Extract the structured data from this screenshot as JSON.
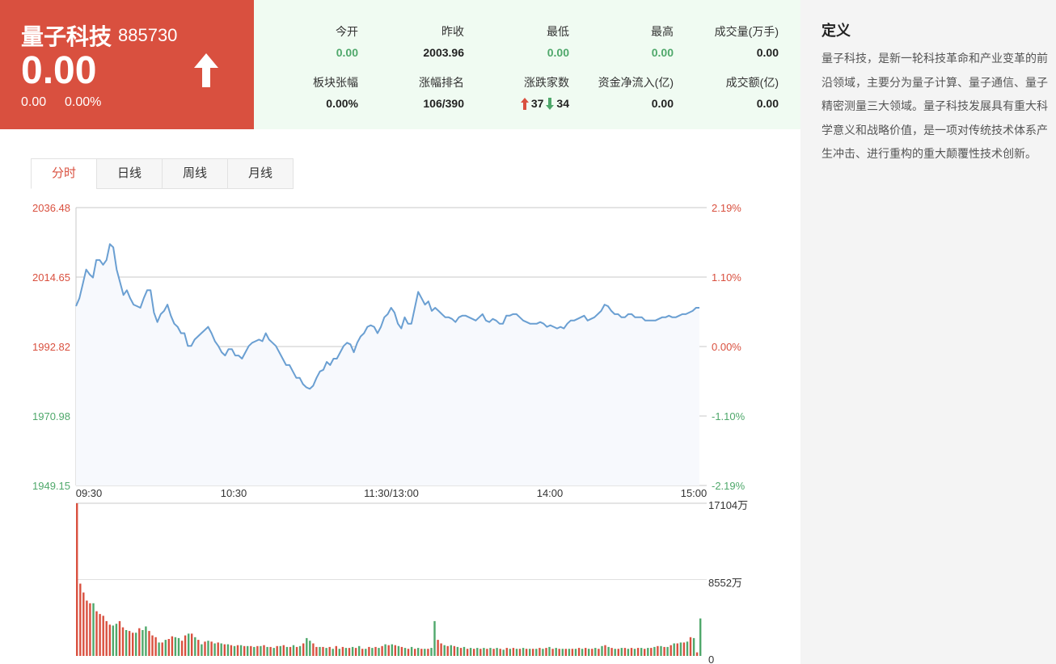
{
  "header": {
    "name": "量子科技",
    "code": "885730",
    "price": "0.00",
    "change": "0.00",
    "change_pct": "0.00%",
    "direction_icon": "arrow-up-icon"
  },
  "stats": {
    "open_label": "今开",
    "open": "0.00",
    "prev_close_label": "昨收",
    "prev_close": "2003.96",
    "low_label": "最低",
    "low": "0.00",
    "high_label": "最高",
    "high": "0.00",
    "volume_label": "成交量(万手)",
    "volume": "0.00",
    "sector_change_label": "板块张幅",
    "sector_change": "0.00%",
    "rank_label": "涨幅排名",
    "rank": "106/390",
    "updown_label": "涨跌家数",
    "up_count": "37",
    "down_count": "34",
    "net_flow_label": "资金净流入(亿)",
    "net_flow": "0.00",
    "turnover_label": "成交额(亿)",
    "turnover": "0.00"
  },
  "definition": {
    "title": "定义",
    "text": "量子科技，是新一轮科技革命和产业变革的前沿领域，主要分为量子计算、量子通信、量子精密测量三大领域。量子科技发展具有重大科学意义和战略价值，是一项对传统技术体系产生冲击、进行重构的重大颠覆性技术创新。"
  },
  "tabs": [
    {
      "label": "分时",
      "active": true
    },
    {
      "label": "日线",
      "active": false
    },
    {
      "label": "周线",
      "active": false
    },
    {
      "label": "月线",
      "active": false
    }
  ],
  "colors": {
    "up": "#d9503f",
    "down": "#4fa86b",
    "line": "#6a9fd2",
    "area": "#f7f9fd",
    "grid": "#c8c8c8"
  },
  "chart_data": [
    {
      "type": "line",
      "title": "",
      "y_tick_labels": [
        "2036.48",
        "2014.65",
        "1992.82",
        "1970.98",
        "1949.15"
      ],
      "pct_tick_labels": [
        "2.19%",
        "1.10%",
        "0.00%",
        "-1.10%",
        "-2.19%"
      ],
      "x_tick_labels": [
        "09:30",
        "10:30",
        "11:30/13:00",
        "14:00",
        "15:00"
      ],
      "ylim": [
        1949.15,
        2036.48
      ],
      "baseline": 1992.82,
      "series": [
        {
          "values": [
            2005.5,
            2008,
            2012.5,
            2017,
            2015.5,
            2014.5,
            2020,
            2020,
            2018.5,
            2020,
            2025,
            2024,
            2017,
            2013,
            2009,
            2010.5,
            2008,
            2006,
            2005.5,
            2005,
            2008,
            2010.5,
            2010.5,
            2003.5,
            2000.5,
            2003,
            2004,
            2006,
            2002.5,
            2000,
            1999,
            1997,
            1997,
            1993,
            1993,
            1995,
            1996,
            1997,
            1998,
            1999,
            1997,
            1994.5,
            1993,
            1991,
            1990,
            1992,
            1992,
            1990,
            1990,
            1989,
            1991,
            1993,
            1994,
            1994.5,
            1995,
            1994.5,
            1997,
            1995,
            1994,
            1993,
            1991,
            1989,
            1987,
            1987,
            1985,
            1983,
            1983,
            1981,
            1980,
            1979.5,
            1980.5,
            1983,
            1985,
            1985.5,
            1988,
            1987,
            1989,
            1989,
            1991,
            1993,
            1994,
            1993.5,
            1991,
            1994,
            1996,
            1997,
            1999,
            1999.5,
            1999,
            1997,
            1999,
            2002,
            2003,
            2005,
            2003.5,
            2000,
            1998.5,
            2002,
            2000,
            2000,
            2005,
            2010,
            2008,
            2006,
            2007,
            2004,
            2005,
            2004,
            2003,
            2002,
            2002,
            2001.5,
            2000.5,
            2002,
            2002.5,
            2002.5,
            2002,
            2001.5,
            2001,
            2002,
            2003,
            2001,
            2000.5,
            2001.5,
            2001,
            2000,
            2000,
            2002.5,
            2002.5,
            2003,
            2003,
            2002,
            2001,
            2000.5,
            2000,
            2000,
            2000,
            2000.5,
            2000,
            1999,
            1999.5,
            1999,
            1998.5,
            1999,
            1998.5,
            2000,
            2001,
            2001,
            2001.5,
            2002,
            2002.5,
            2001,
            2001.5,
            2002,
            2003,
            2004,
            2006,
            2005.5,
            2004,
            2003,
            2003,
            2002,
            2002,
            2003,
            2003,
            2002,
            2002,
            2002,
            2001,
            2001,
            2001,
            2001,
            2001.5,
            2002,
            2002,
            2002.5,
            2002,
            2002,
            2002.5,
            2003,
            2003,
            2003.5,
            2004,
            2005,
            2005
          ]
        }
      ]
    },
    {
      "type": "bar",
      "title": "",
      "y_tick_labels": [
        "17104万",
        "8552万",
        "0"
      ],
      "ylim": [
        0,
        17104
      ],
      "values": [
        17104,
        8100,
        7100,
        6200,
        5900,
        5900,
        5000,
        4700,
        4500,
        3900,
        3500,
        3400,
        3600,
        3900,
        3200,
        2900,
        2800,
        2600,
        2600,
        3100,
        2900,
        3300,
        2800,
        2300,
        2100,
        1500,
        1500,
        1800,
        1900,
        2200,
        2100,
        2000,
        1700,
        2300,
        2500,
        2500,
        2100,
        1800,
        1300,
        1600,
        1700,
        1600,
        1400,
        1500,
        1400,
        1300,
        1300,
        1200,
        1100,
        1200,
        1200,
        1100,
        1100,
        1100,
        1000,
        1100,
        1100,
        1200,
        1000,
        1000,
        900,
        1100,
        1100,
        1200,
        1000,
        1000,
        1200,
        1000,
        1100,
        1400,
        2000,
        1700,
        1400,
        1000,
        1000,
        1000,
        900,
        1000,
        800,
        1100,
        800,
        1000,
        900,
        900,
        1000,
        900,
        1100,
        800,
        800,
        1000,
        900,
        1000,
        900,
        1100,
        1300,
        1200,
        1300,
        1200,
        1100,
        1000,
        900,
        800,
        1000,
        800,
        900,
        800,
        800,
        800,
        900,
        3900,
        1800,
        1400,
        1200,
        1100,
        1200,
        1100,
        1000,
        900,
        1000,
        800,
        900,
        800,
        900,
        800,
        900,
        800,
        900,
        800,
        900,
        800,
        700,
        900,
        800,
        900,
        800,
        800,
        900,
        800,
        800,
        800,
        800,
        900,
        800,
        900,
        1000,
        800,
        900,
        800,
        800,
        800,
        800,
        800,
        800,
        900,
        800,
        900,
        800,
        800,
        900,
        800,
        1100,
        1200,
        1000,
        900,
        800,
        800,
        900,
        900,
        800,
        900,
        800,
        900,
        900,
        800,
        900,
        900,
        1000,
        1100,
        1100,
        1000,
        1000,
        1200,
        1400,
        1400,
        1500,
        1500,
        1600,
        2100,
        2000,
        400,
        4200
      ],
      "colors": [
        "up",
        "up",
        "up",
        "up",
        "up",
        "down",
        "up",
        "up",
        "up",
        "up",
        "up",
        "down",
        "down",
        "up",
        "up",
        "down",
        "up",
        "up",
        "down",
        "up",
        "down",
        "down",
        "up",
        "up",
        "up",
        "down",
        "up",
        "down",
        "up",
        "up",
        "down",
        "down",
        "up",
        "up",
        "down",
        "up",
        "down",
        "up",
        "down",
        "up",
        "down",
        "up",
        "down",
        "up",
        "down",
        "up",
        "down",
        "up",
        "down",
        "up",
        "down",
        "up",
        "down",
        "up",
        "down",
        "up",
        "down",
        "up",
        "down",
        "up",
        "down",
        "up",
        "down",
        "up",
        "down",
        "up",
        "down",
        "up",
        "down",
        "up",
        "down",
        "down",
        "up",
        "up",
        "down",
        "up",
        "down",
        "up",
        "down",
        "up",
        "down",
        "up",
        "down",
        "up",
        "down",
        "up",
        "down",
        "up",
        "down",
        "up",
        "down",
        "up",
        "down",
        "up",
        "down",
        "up",
        "down",
        "up",
        "down",
        "up",
        "down",
        "up",
        "down",
        "up",
        "down",
        "up",
        "down",
        "up",
        "down",
        "down",
        "up",
        "up",
        "down",
        "up",
        "down",
        "up",
        "down",
        "up",
        "down",
        "up",
        "down",
        "up",
        "down",
        "up",
        "down",
        "up",
        "down",
        "up",
        "down",
        "up",
        "down",
        "up",
        "down",
        "up",
        "down",
        "up",
        "down",
        "up",
        "down",
        "up",
        "down",
        "up",
        "down",
        "up",
        "down",
        "up",
        "down",
        "up",
        "down",
        "up",
        "down",
        "up",
        "down",
        "up",
        "down",
        "up",
        "down",
        "up",
        "down",
        "up",
        "down",
        "up",
        "down",
        "up",
        "down",
        "up",
        "down",
        "up",
        "down",
        "up",
        "down",
        "up",
        "down",
        "up",
        "down",
        "up",
        "down",
        "up",
        "down",
        "up",
        "down",
        "up",
        "down",
        "up",
        "down",
        "up",
        "down",
        "up",
        "down",
        "up",
        "down",
        "up",
        "down",
        "up",
        "down",
        "up",
        "up",
        "down"
      ]
    }
  ]
}
